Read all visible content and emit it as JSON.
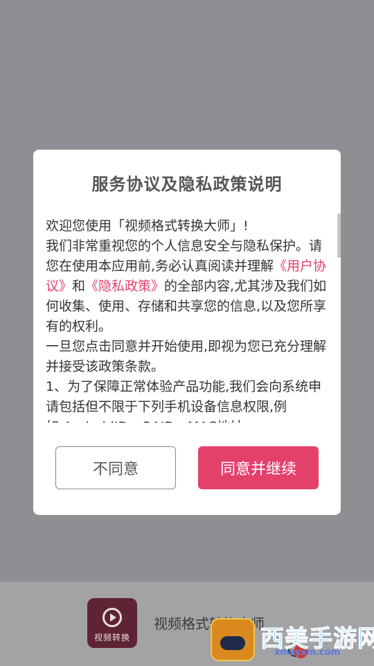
{
  "dialog": {
    "title": "服务协议及隐私政策说明",
    "paragraphs": {
      "welcome": "欢迎您使用「视频格式转换大师」!",
      "p1_start": " 我们非常重视您的个人信息安全与隐私保护。请您在使用本应用前,务必认真阅读并理解",
      "user_agreement_link": "《用户协议》",
      "and": "和",
      "privacy_policy_link": "《隐私政策》",
      "p1_end": "的全部内容,尤其涉及我们如何收集、使用、存储和共享您的信息,以及您所享有的权利。",
      "p2": " 一旦您点击同意并开始使用,即视为您已充分理解并接受该政策条款。",
      "p3": " 1、为了保障正常体验产品功能,我们会向系统申请包括但不限于下列手机设备信息权限,例如:AndroidID、OAID、MAC地址"
    },
    "buttons": {
      "disagree": "不同意",
      "agree": "同意并继续"
    },
    "colors": {
      "accent": "#e3406a",
      "link": "#e2416b"
    }
  },
  "background_app": {
    "icon_label": "视频转换",
    "name": "视频格式转换大师"
  },
  "watermark": {
    "title": "西美手游网",
    "url": "xmsyxm.com"
  }
}
